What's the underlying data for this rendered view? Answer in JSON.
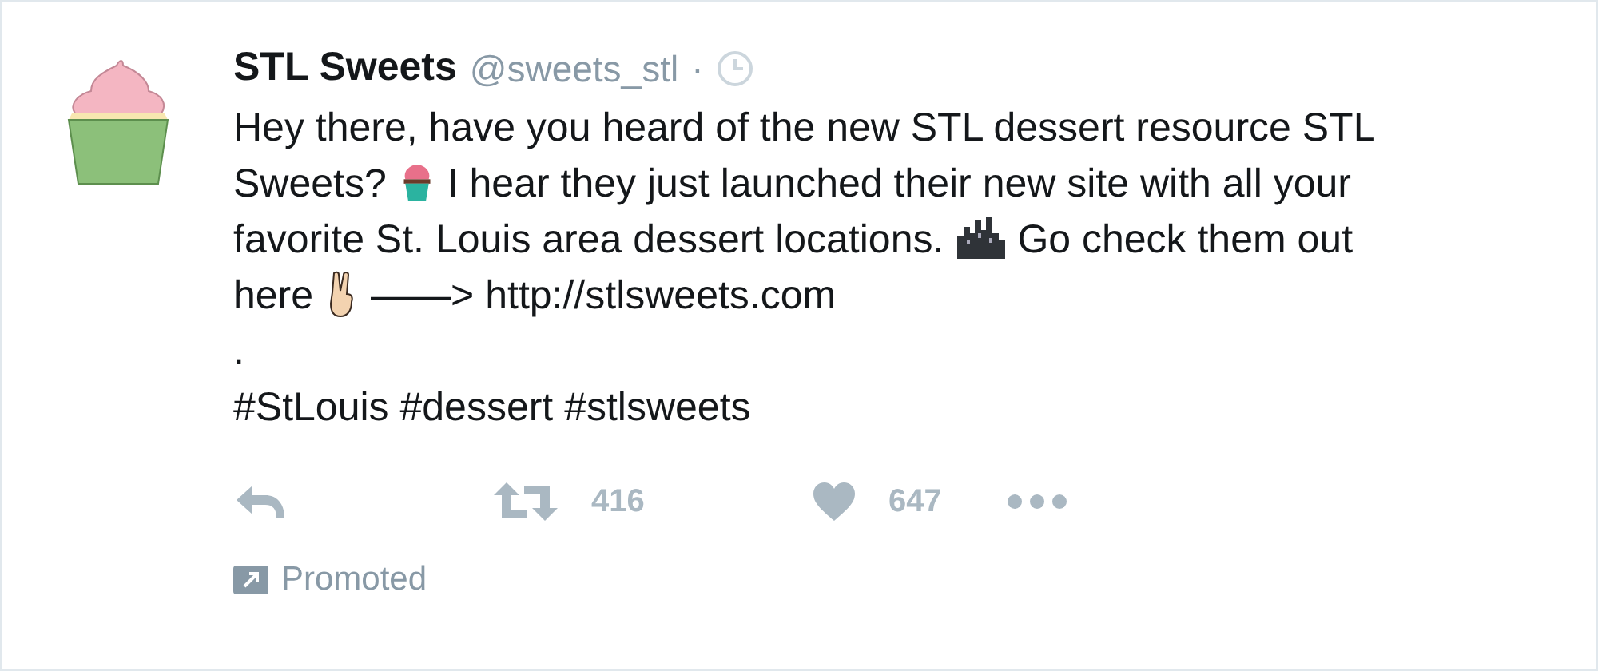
{
  "tweet": {
    "name": "STL Sweets",
    "handle": "@sweets_stl",
    "separator": "·",
    "body": [
      [
        {
          "kind": "text",
          "text": "Hey there, have you heard of the new STL dessert resource STL"
        }
      ],
      [
        {
          "kind": "text",
          "text": "Sweets?"
        },
        {
          "kind": "cupcake"
        },
        {
          "kind": "text",
          "text": "I hear they just launched their new site with all your"
        }
      ],
      [
        {
          "kind": "text",
          "text": "favorite St. Louis area dessert locations."
        },
        {
          "kind": "city"
        },
        {
          "kind": "text",
          "text": "Go check them out"
        }
      ],
      [
        {
          "kind": "text",
          "text": "here"
        },
        {
          "kind": "victory"
        },
        {
          "kind": "text",
          "text": "——> http://stlsweets.com"
        }
      ],
      [
        {
          "kind": "text",
          "text": "."
        }
      ],
      [
        {
          "kind": "text",
          "text": "#StLouis #dessert #stlsweets"
        }
      ]
    ],
    "actions": [
      {
        "kind": "reply"
      },
      {
        "kind": "retweet",
        "count": "416"
      },
      {
        "kind": "like",
        "count": "647"
      },
      {
        "kind": "more"
      }
    ],
    "promoted": "Promoted"
  }
}
